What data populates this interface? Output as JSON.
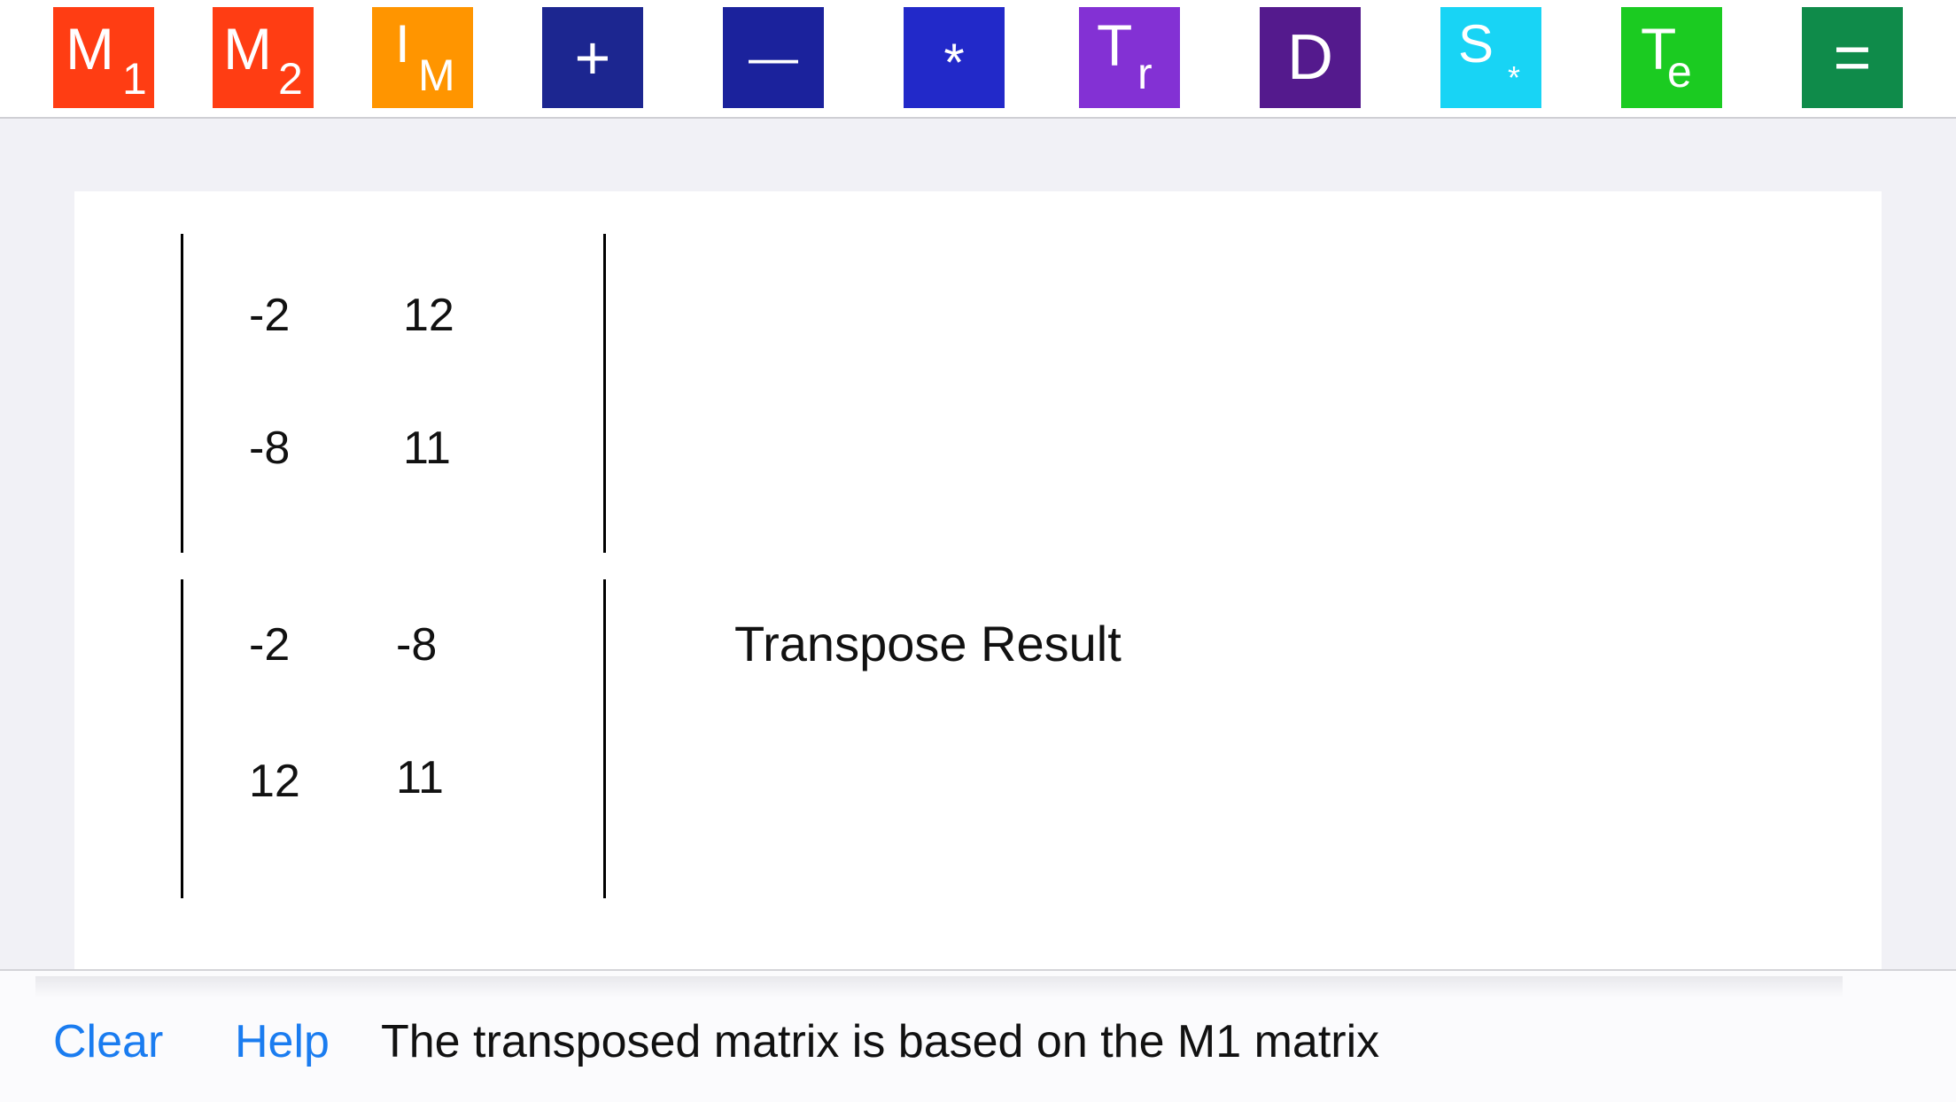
{
  "toolbar": {
    "m1": {
      "main": "M",
      "sub": "1",
      "color": "#ff3d13"
    },
    "m2": {
      "main": "M",
      "sub": "2",
      "color": "#ff3d13"
    },
    "im": {
      "main": "I",
      "sub": "M",
      "color": "#ff9500"
    },
    "add": {
      "label": "+",
      "color": "#1c2690"
    },
    "subtract": {
      "label": "—",
      "color": "#1b229c"
    },
    "multiply": {
      "label": "*",
      "color": "#2229c9"
    },
    "transpose": {
      "main": "T",
      "sub": "r",
      "color": "#8331d4"
    },
    "determinant": {
      "label": "D",
      "color": "#541a8d"
    },
    "scalar": {
      "main": "S",
      "sub": "*",
      "color": "#18d4f5"
    },
    "te": {
      "main": "T",
      "sub": "e",
      "color": "#1bcb21"
    },
    "equals": {
      "label": "=",
      "color": "#0f8b4a"
    }
  },
  "input_matrix": {
    "rows": [
      [
        "-2",
        "12"
      ],
      [
        "-8",
        "11"
      ]
    ]
  },
  "result_matrix": {
    "rows": [
      [
        "-2",
        "-8"
      ],
      [
        "12",
        "11"
      ]
    ],
    "label": "Transpose Result"
  },
  "bottom_bar": {
    "clear_label": "Clear",
    "help_label": "Help",
    "status_text": "The transposed matrix is based on the M1 matrix",
    "link_color": "#1a7cf0"
  }
}
